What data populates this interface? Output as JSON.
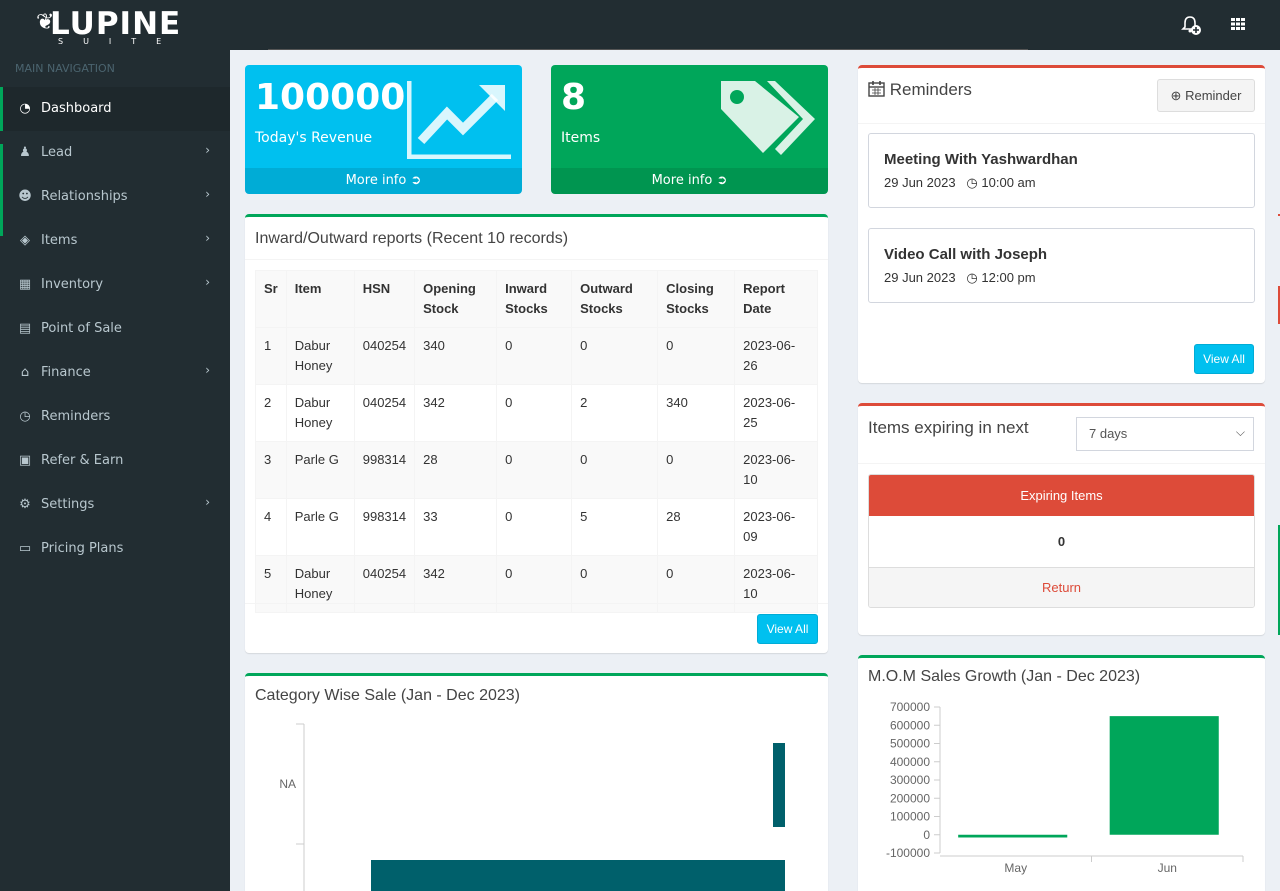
{
  "brand": {
    "name": "LUPINE",
    "tagline": "SUITE"
  },
  "sidebar": {
    "header": "MAIN NAVIGATION",
    "items": [
      {
        "label": "Dashboard",
        "icon": "dashboard-icon",
        "glyph": "◔",
        "chevron": false,
        "active": true
      },
      {
        "label": "Lead",
        "icon": "user-icon",
        "glyph": "♟",
        "chevron": true
      },
      {
        "label": "Relationships",
        "icon": "users-icon",
        "glyph": "☻",
        "chevron": true
      },
      {
        "label": "Items",
        "icon": "tag-icon",
        "glyph": "◈",
        "chevron": true
      },
      {
        "label": "Inventory",
        "icon": "cubes-icon",
        "glyph": "▦",
        "chevron": true
      },
      {
        "label": "Point of Sale",
        "icon": "print-icon",
        "glyph": "▤",
        "chevron": false
      },
      {
        "label": "Finance",
        "icon": "bank-icon",
        "glyph": "⌂",
        "chevron": true
      },
      {
        "label": "Reminders",
        "icon": "clock-icon",
        "glyph": "◷",
        "chevron": false
      },
      {
        "label": "Refer & Earn",
        "icon": "money-icon",
        "glyph": "▣",
        "chevron": false
      },
      {
        "label": "Settings",
        "icon": "cogs-icon",
        "glyph": "⚙",
        "chevron": true
      },
      {
        "label": "Pricing Plans",
        "icon": "credit-card-icon",
        "glyph": "▭",
        "chevron": false
      }
    ]
  },
  "stats": {
    "revenue": {
      "value": "100000",
      "label": "Today's Revenue",
      "more": "More info",
      "color": "#00c0ef"
    },
    "items": {
      "value": "8",
      "label": "Items",
      "more": "More info",
      "color": "#00a65a"
    }
  },
  "report": {
    "title": "Inward/Outward reports (Recent 10 records)",
    "columns": [
      "Sr",
      "Item",
      "HSN",
      "Opening Stock",
      "Inward Stocks",
      "Outward Stocks",
      "Closing Stocks",
      "Report Date"
    ],
    "rows": [
      [
        "1",
        "Dabur Honey",
        "040254",
        "340",
        "0",
        "0",
        "0",
        "2023-06-26"
      ],
      [
        "2",
        "Dabur Honey",
        "040254",
        "342",
        "0",
        "2",
        "340",
        "2023-06-25"
      ],
      [
        "3",
        "Parle G",
        "998314",
        "28",
        "0",
        "0",
        "0",
        "2023-06-10"
      ],
      [
        "4",
        "Parle G",
        "998314",
        "33",
        "0",
        "5",
        "28",
        "2023-06-09"
      ],
      [
        "5",
        "Dabur Honey",
        "040254",
        "342",
        "0",
        "0",
        "0",
        "2023-06-10"
      ]
    ],
    "view_all": "View All"
  },
  "reminders": {
    "title": "Reminders",
    "add_button": "Reminder",
    "items": [
      {
        "title": "Meeting With Yashwardhan",
        "date": "29 Jun 2023",
        "time": "10:00 am"
      },
      {
        "title": "Video Call with Joseph",
        "date": "29 Jun 2023",
        "time": "12:00 pm"
      }
    ],
    "view_all": "View All"
  },
  "expiring": {
    "title": "Items expiring in next",
    "selected": "7 days",
    "header": "Expiring Items",
    "count": "0",
    "return": "Return"
  },
  "chart_data": [
    {
      "type": "bar",
      "title": "Category Wise Sale (Jan - Dec 2023)",
      "orientation": "horizontal",
      "categories": [
        "NA"
      ],
      "color": "#00606b"
    },
    {
      "type": "bar",
      "title": "M.O.M Sales Growth (Jan - Dec 2023)",
      "categories": [
        "May",
        "Jun"
      ],
      "values": [
        -15000,
        650000
      ],
      "ylim": [
        -100000,
        700000
      ],
      "yticks": [
        700000,
        600000,
        500000,
        400000,
        300000,
        200000,
        100000,
        0,
        -100000
      ],
      "color": "#00a65a"
    }
  ]
}
